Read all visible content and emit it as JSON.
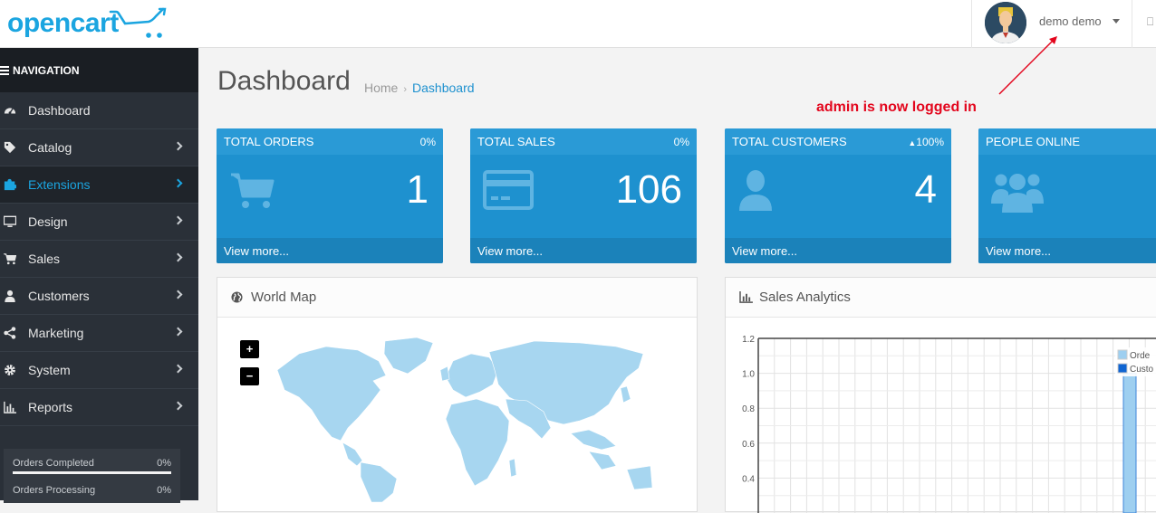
{
  "header": {
    "logo_text": "opencart",
    "user_name": "demo demo"
  },
  "sidebar": {
    "heading": "NAVIGATION",
    "items": [
      {
        "label": "Dashboard",
        "icon": "dashboard-icon"
      },
      {
        "label": "Catalog",
        "icon": "tag-icon"
      },
      {
        "label": "Extensions",
        "icon": "puzzle-icon"
      },
      {
        "label": "Design",
        "icon": "monitor-icon"
      },
      {
        "label": "Sales",
        "icon": "cart-icon"
      },
      {
        "label": "Customers",
        "icon": "user-icon"
      },
      {
        "label": "Marketing",
        "icon": "share-icon"
      },
      {
        "label": "System",
        "icon": "gear-icon"
      },
      {
        "label": "Reports",
        "icon": "bar-chart-icon"
      }
    ],
    "progress": [
      {
        "label": "Orders Completed",
        "value": "0%"
      },
      {
        "label": "Orders Processing",
        "value": "0%"
      }
    ]
  },
  "main": {
    "title": "Dashboard",
    "breadcrumb": {
      "home": "Home",
      "current": "Dashboard"
    },
    "annotation": "admin is now logged in",
    "tiles": [
      {
        "title": "TOTAL ORDERS",
        "percent": "0%",
        "value": "1",
        "footer": "View more...",
        "icon": "cart-icon"
      },
      {
        "title": "TOTAL SALES",
        "percent": "0%",
        "value": "106",
        "footer": "View more...",
        "icon": "credit-card-icon"
      },
      {
        "title": "TOTAL CUSTOMERS",
        "percent": "100%",
        "value": "4",
        "footer": "View more...",
        "icon": "user-icon"
      },
      {
        "title": "PEOPLE ONLINE",
        "percent": "",
        "value": "",
        "footer": "View more...",
        "icon": "users-icon"
      }
    ],
    "world_map": {
      "title": "World Map",
      "zoom_in": "+",
      "zoom_out": "−"
    },
    "sales_analytics": {
      "title": "Sales Analytics",
      "chart_data": {
        "type": "bar",
        "y_ticks": [
          "1.2",
          "1.0",
          "0.8",
          "0.6",
          "0.4"
        ],
        "ylim": [
          0.4,
          1.2
        ],
        "legend": [
          "Orders",
          "Customers"
        ],
        "legend_visible": [
          "Orde",
          "Custo"
        ],
        "series": [
          {
            "name": "Orders",
            "values": [
              1.0
            ]
          }
        ],
        "colors": {
          "orders": "#9ecff0",
          "customers": "#1065d2"
        }
      }
    }
  },
  "colors": {
    "accent": "#1e91cf",
    "sidebar": "#2a3038",
    "annotation": "#e3061d"
  }
}
